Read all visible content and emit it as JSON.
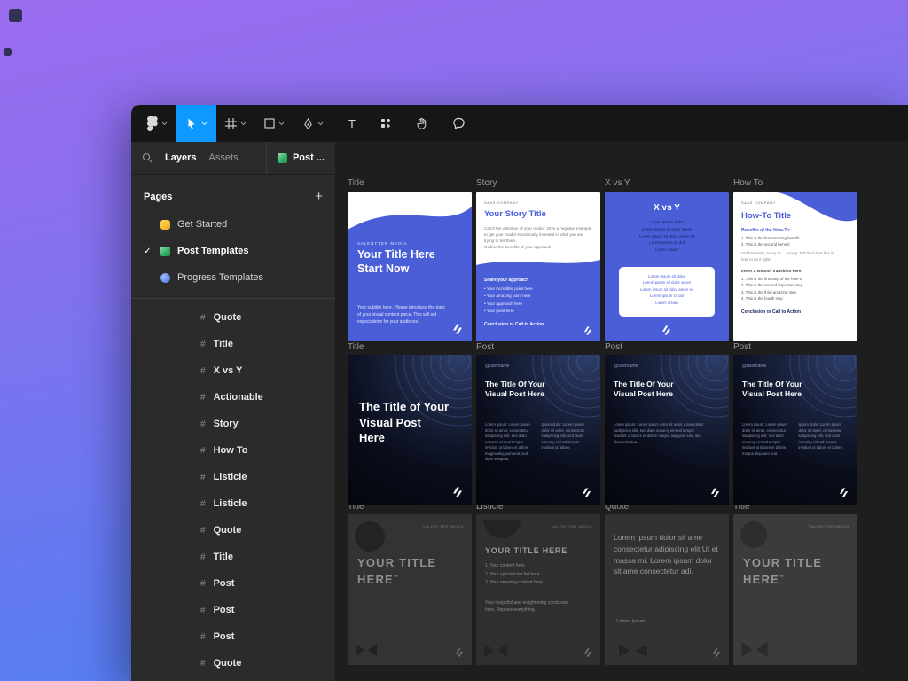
{
  "toolbar": {
    "tools": [
      "main-menu",
      "move",
      "frame",
      "shape",
      "pen",
      "text",
      "resources",
      "hand",
      "comment"
    ],
    "selected_tool": "move",
    "accent_color": "#0d99ff"
  },
  "sidebar": {
    "tabs": {
      "layers": "Layers",
      "assets": "Assets",
      "page_tab": "Post ..."
    },
    "pages": {
      "header": "Pages",
      "add": "+",
      "items": [
        {
          "icon": "hand-emoji",
          "label": "Get Started",
          "selected": false
        },
        {
          "icon": "picture-emoji",
          "label": "Post Templates",
          "selected": true
        },
        {
          "icon": "globe-emoji",
          "label": "Progress Templates",
          "selected": false
        }
      ]
    },
    "layers": [
      {
        "label": "Quote"
      },
      {
        "label": "Title"
      },
      {
        "label": "X vs Y"
      },
      {
        "label": "Actionable"
      },
      {
        "label": "Story"
      },
      {
        "label": "How To"
      },
      {
        "label": "Listicle"
      },
      {
        "label": "Listicle"
      },
      {
        "label": "Quote"
      },
      {
        "label": "Title"
      },
      {
        "label": "Post"
      },
      {
        "label": "Post"
      },
      {
        "label": "Post"
      },
      {
        "label": "Quote"
      }
    ]
  },
  "canvas": {
    "frames": {
      "f1": {
        "label": "Title",
        "brand": "VALENTTER MEDIA",
        "heading": "Your Title Here\nStart Now",
        "body": "Your subtitle here. Please introduce the topic of your visual content piece. This will set expectations for your audience."
      },
      "f2": {
        "label": "Story",
        "brand": "SAAS COMPANY",
        "heading": "Your Story Title",
        "body": "Catch the attention of your reader. Give a negative example to get your reader emotionally invested in what you are trying to tell them.\nOutline the benefits of your approach.",
        "list_title": "Share your approach",
        "list": "• Your incredible point here\n• Your amazing point here\n• Your approach here\n• Your point here",
        "cta": "Conclusion or Call to Action"
      },
      "f3": {
        "label": "X vs Y",
        "heading": "X vs Y",
        "top_text": "Lorem ipsum dolor\nLorem ipsum sit dolor amen\nLorem ipsum sit dolor amen sit\nLorem ipsum sit dol\nLorem ipsum",
        "panel_text": "Lorem ipsum sit dolor\nLorem ipsum sit dolor amen\nLorem ipsum sit dolor amen sit\nLorem ipsum sit dol\nLorem ipsum"
      },
      "f4": {
        "label": "How To",
        "brand": "SAAS COMPANY",
        "heading": "How-To Title",
        "benefits_title": "Benefits of the How-To:",
        "benefits": "1. This is the first amazing benefit\n2. This is the second benefit",
        "para": "Unfortunately, many do ... wrong. Tell them that this is how to do it right.",
        "transition": "Insert a smooth transition here:",
        "steps": "1. This is the first step of the how-to\n2. This is the second important step\n3. This is the third amazing step\n4. This is the fourth step",
        "cta": "Conclusion or Call to Action"
      },
      "f5": {
        "label": "Title",
        "heading": "The Title of Your Visual Post Here"
      },
      "f6": {
        "label": "Post",
        "username": "@username",
        "heading": "The Title Of Your Visual Post Here",
        "col1": "Lorem ipsum: Lorem ipsum dolor sit amet, consectetur sadipscing elitr, sed diam nonumy eirmod tempor invidunt ut labore et dolore magna aliquyam erat, sed diam voluptua.",
        "col2": "Ipsum dolor: Lorem ipsum dolor sit amet, consectetur sadipscing elitr, sed diam nonumy eirmod tempor invidunt ut labore."
      },
      "f7": {
        "label": "Post",
        "username": "@username",
        "heading": "The Title Of Your Visual Post Here",
        "body": "Lorem ipsum: Lorem ipsum dolor sit amet, consectetur sadipscing elitr, sed diam nonumy eirmod tempor invidunt ut labore et dolore magna aliquyam erat, sed diam voluptua."
      },
      "f8": {
        "label": "Post",
        "username": "@username",
        "heading": "The Title Of Your Visual Post Here",
        "col1": "Lorem ipsum: Lorem ipsum dolor sit amet, consectetur sadipscing elitr, sed diam nonumy eirmod tempor invidunt ut labore et dolore magna aliquyam erat.",
        "col2": "Ipsum dolor: Lorem ipsum dolor sit amet, consectetur sadipscing elitr, sed diam nonumy eirmod tempor invidunt ut labore et dolore."
      },
      "f9": {
        "label": "Title",
        "brand": "VALENTTER MEDIA",
        "heading": "YOUR TITLE HERE",
        "tm": "™"
      },
      "f10": {
        "label": "Listicle",
        "brand": "VALENTTER MEDIA",
        "heading": "YOUR TITLE HERE",
        "list": "1. Your content here\n2. Your spectacular list here\n3. Your amazing content here",
        "body": "Your insightful and enlightening conclusion here. Replace everything."
      },
      "f11": {
        "label": "Quote",
        "quote": "Lorem ipsum dolor sit ame consectetur adipiscing elit Ut et massa mi. Lorem ipsum dolor sit ame consectetur adi.",
        "attribution": "- Lorem Ipsum"
      },
      "f12": {
        "label": "Title",
        "brand": "VALENTTER MEDIA",
        "heading": "YOUR TITLE HERE",
        "tm": "™"
      }
    }
  },
  "colors": {
    "accent": "#0d99ff",
    "template_blue": "#4a5ed8",
    "toolbar_bg": "#161616",
    "sidebar_bg": "#2b2b2b",
    "canvas_bg": "#1e1e1e"
  }
}
